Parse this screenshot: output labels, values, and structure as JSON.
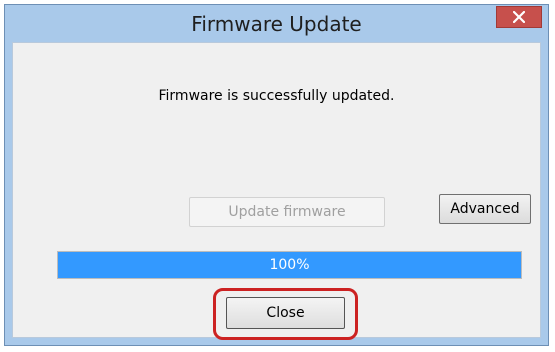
{
  "window": {
    "title": "Firmware Update",
    "close_icon": "close-icon"
  },
  "dialog": {
    "message": "Firmware is successfully updated.",
    "update_button_label": "Update firmware",
    "update_button_enabled": false,
    "advanced_button_label": "Advanced",
    "close_button_label": "Close"
  },
  "progress": {
    "percent": 100,
    "label": "100%"
  },
  "colors": {
    "titlebar": "#a9c9ea",
    "close_button": "#c7504c",
    "progress_fill": "#3399ff",
    "highlight": "#cc2222"
  }
}
